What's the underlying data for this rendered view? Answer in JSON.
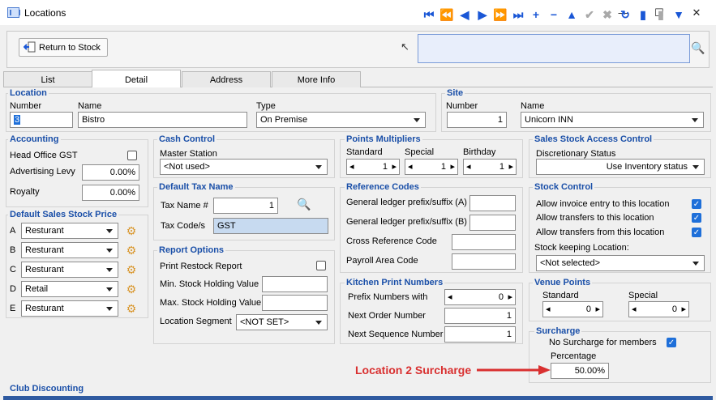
{
  "window": {
    "title": "Locations",
    "minimize": "—",
    "maximize": "☐",
    "close": "✕"
  },
  "toolbar": {
    "return_label": "Return to Stock"
  },
  "tabs": [
    {
      "label": "List"
    },
    {
      "label": "Detail"
    },
    {
      "label": "Address"
    },
    {
      "label": "More Info"
    }
  ],
  "location": {
    "group": "Location",
    "number_label": "Number",
    "number": "3",
    "name_label": "Name",
    "name": "Bistro",
    "type_label": "Type",
    "type": "On Premise"
  },
  "site": {
    "group": "Site",
    "number_label": "Number",
    "number": "1",
    "name_label": "Name",
    "name": "Unicorn INN"
  },
  "accounting": {
    "group": "Accounting",
    "head_office_label": "Head Office GST",
    "advertising_label": "Advertising Levy",
    "advertising": "0.00%",
    "royalty_label": "Royalty",
    "royalty": "0.00%"
  },
  "cash_control": {
    "group": "Cash Control",
    "master_label": "Master Station",
    "master": "<Not used>"
  },
  "points": {
    "group": "Points Multipliers",
    "standard_label": "Standard",
    "standard": "1",
    "special_label": "Special",
    "special": "1",
    "birthday_label": "Birthday",
    "birthday": "1"
  },
  "sales_access": {
    "group": "Sales Stock Access Control",
    "disc_label": "Discretionary Status",
    "disc": "Use Inventory status"
  },
  "default_price": {
    "group": "Default Sales Stock Price",
    "rows": [
      {
        "letter": "A",
        "value": "Resturant"
      },
      {
        "letter": "B",
        "value": "Resturant"
      },
      {
        "letter": "C",
        "value": "Resturant"
      },
      {
        "letter": "D",
        "value": "Retail"
      },
      {
        "letter": "E",
        "value": "Resturant"
      }
    ]
  },
  "tax": {
    "group": "Default Tax Name",
    "name_label": "Tax Name #",
    "name": "1",
    "code_label": "Tax Code/s",
    "code": "GST"
  },
  "refcodes": {
    "group": "Reference Codes",
    "gl_a_label": "General ledger prefix/suffix (A)",
    "gl_b_label": "General ledger prefix/suffix (B)",
    "xref_label": "Cross Reference Code",
    "payroll_label": "Payroll Area Code"
  },
  "stock_control": {
    "group": "Stock Control",
    "invoice_label": "Allow invoice entry to this location",
    "to_label": "Allow transfers to this location",
    "from_label": "Allow transfers from this location",
    "keeping_label": "Stock keeping Location:",
    "keeping": "<Not selected>"
  },
  "report": {
    "group": "Report Options",
    "restock_label": "Print Restock Report",
    "min_label": "Min. Stock Holding Value",
    "max_label": "Max. Stock Holding Value",
    "segment_label": "Location Segment",
    "segment": "<NOT SET>"
  },
  "kitchen": {
    "group": "Kitchen Print Numbers",
    "prefix_label": "Prefix Numbers with",
    "prefix": "0",
    "next_order_label": "Next Order Number",
    "next_order": "1",
    "next_seq_label": "Next Sequence Number",
    "next_seq": "1"
  },
  "venue": {
    "group": "Venue Points",
    "standard_label": "Standard",
    "standard": "0",
    "special_label": "Special",
    "special": "0"
  },
  "surcharge": {
    "group": "Surcharge",
    "no_members_label": "No Surcharge for members",
    "pct_label": "Percentage",
    "pct": "50.00%",
    "annotation": "Location 2 Surcharge"
  },
  "club": {
    "group": "Club Discounting"
  }
}
